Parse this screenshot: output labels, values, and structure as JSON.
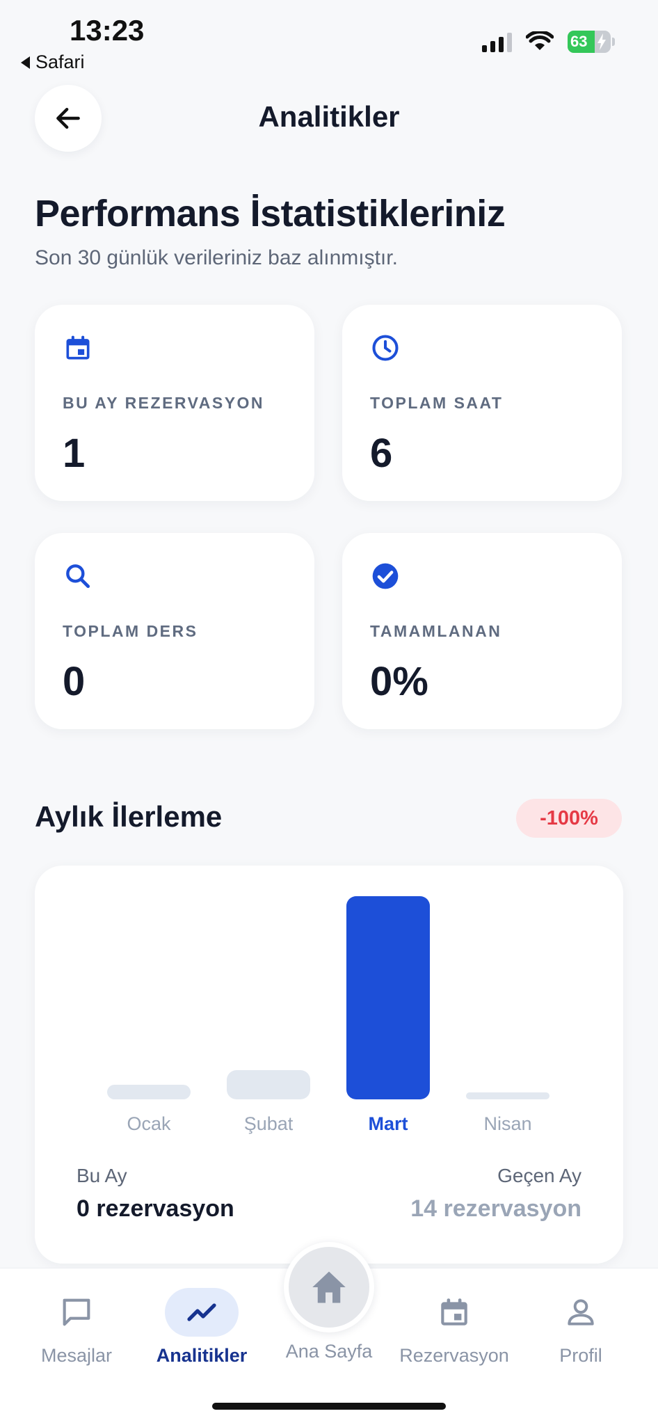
{
  "status_bar": {
    "time": "13:23",
    "back_app": "Safari",
    "battery": "63"
  },
  "header": {
    "title": "Analitikler"
  },
  "intro": {
    "title": "Performans İstatistikleriniz",
    "subtitle": "Son 30 günlük verileriniz baz alınmıştır."
  },
  "stats": [
    {
      "icon": "calendar-icon",
      "label": "BU AY REZERVASYON",
      "value": "1"
    },
    {
      "icon": "clock-icon",
      "label": "TOPLAM SAAT",
      "value": "6"
    },
    {
      "icon": "search-icon",
      "label": "TOPLAM DERS",
      "value": "0"
    },
    {
      "icon": "check-circle-icon",
      "label": "TAMAMLANAN",
      "value": "0%"
    }
  ],
  "progress": {
    "title": "Aylık İlerleme",
    "change": "-100%",
    "this_month_label": "Bu Ay",
    "this_month_value": "0 rezervasyon",
    "last_month_label": "Geçen Ay",
    "last_month_value": "14 rezervasyon"
  },
  "chart_data": {
    "type": "bar",
    "categories": [
      "Ocak",
      "Şubat",
      "Mart",
      "Nisan"
    ],
    "values": [
      1,
      2,
      14,
      0
    ],
    "highlighted": "Mart",
    "ylim": [
      0,
      14
    ],
    "grid": false,
    "colors": {
      "bar": "#e2e8f0",
      "highlight": "#1d4fd8"
    }
  },
  "tabbar": {
    "items": [
      {
        "label": "Mesajlar",
        "icon": "message-icon"
      },
      {
        "label": "Analitikler",
        "icon": "trending-up-icon",
        "active": true
      },
      {
        "label": "Ana Sayfa",
        "icon": "home-icon"
      },
      {
        "label": "Rezervasyon",
        "icon": "calendar-icon"
      },
      {
        "label": "Profil",
        "icon": "user-icon"
      }
    ]
  },
  "colors": {
    "accent": "#1d4fd8",
    "danger": "#e53945",
    "background": "#f7f8fa"
  }
}
